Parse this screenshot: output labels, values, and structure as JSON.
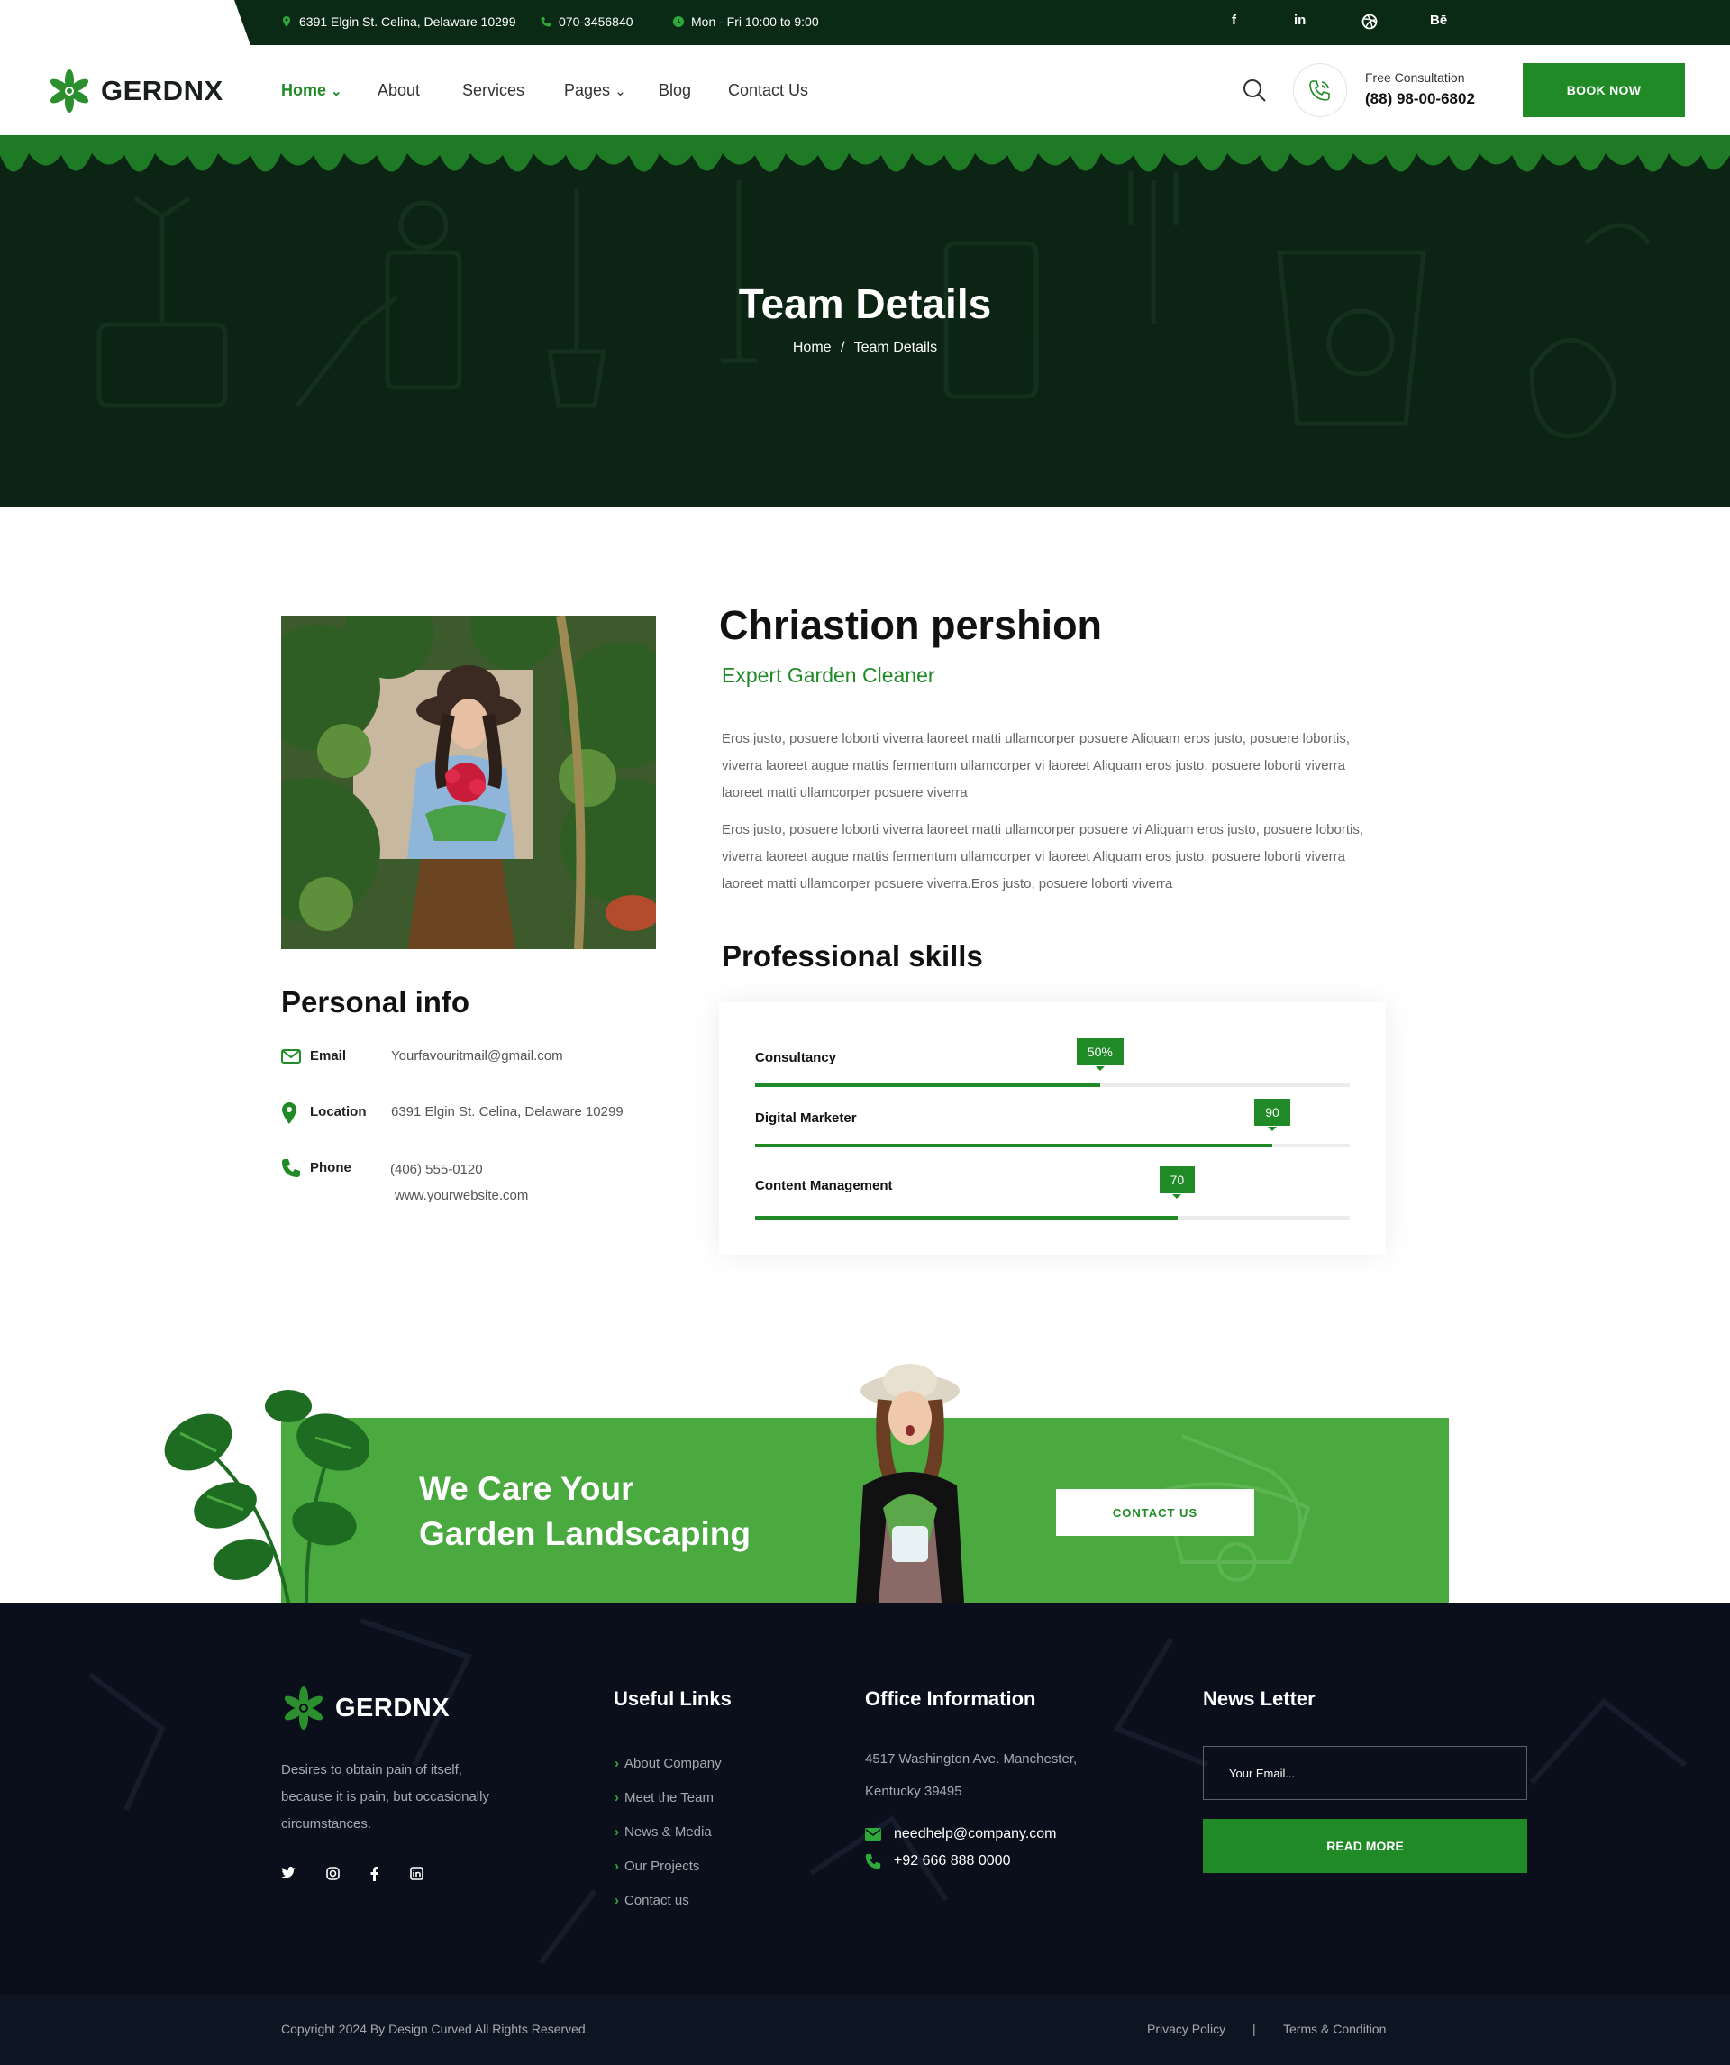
{
  "topbar": {
    "address": "6391 Elgin St. Celina, Delaware 10299",
    "phone": "070-3456840",
    "hours": "Mon - Fri 10:00 to 9:00",
    "social": [
      "f",
      "in",
      "dribbble-icon",
      "Bē"
    ]
  },
  "header": {
    "brand": "GERDNX",
    "nav": [
      "Home",
      "About",
      "Services",
      "Pages",
      "Blog",
      "Contact Us"
    ],
    "consult_label": "Free Consultation",
    "consult_phone": "(88) 98-00-6802",
    "book_label": "BOOK NOW"
  },
  "hero": {
    "title": "Team Details",
    "crumb_home": "Home",
    "crumb_sep": "/",
    "crumb_current": "Team Details"
  },
  "profile": {
    "name": "Chriastion pershion",
    "role": "Expert Garden Cleaner",
    "para1": "Eros justo, posuere loborti viverra laoreet matti ullamcorper posuere Aliquam eros justo, posuere lobortis, viverra laoreet augue mattis fermentum ullamcorper vi laoreet Aliquam eros justo, posuere loborti viverra laoreet matti ullamcorper posuere viverra",
    "para2": "Eros justo, posuere loborti viverra laoreet matti ullamcorper posuere vi Aliquam eros justo, posuere lobortis, viverra laoreet augue mattis fermentum ullamcorper vi laoreet Aliquam eros justo, posuere loborti viverra laoreet matti ullamcorper posuere viverra.Eros justo, posuere loborti viverra"
  },
  "personal": {
    "title": "Personal info",
    "email_label": "Email",
    "email": "Yourfavouritmail@gmail.com",
    "location_label": "Location",
    "location": "6391 Elgin St. Celina, Delaware 10299",
    "phone_label": "Phone",
    "phone": "(406) 555-0120",
    "website": "www.yourwebsite.com"
  },
  "skills": {
    "title": "Professional skills",
    "items": [
      {
        "label": "Consultancy",
        "badge": "50%",
        "value": 58
      },
      {
        "label": "Digital Marketer",
        "badge": "90",
        "value": 87
      },
      {
        "label": "Content Management",
        "badge": "70",
        "value": 71
      }
    ]
  },
  "cta": {
    "line1": "We Care Your",
    "line2": "Garden Landscaping",
    "button": "CONTACT US"
  },
  "footer": {
    "brand": "GERDNX",
    "about": [
      "Desires to obtain pain of itself,",
      "because it is pain, but occasionally",
      "circumstances."
    ],
    "links_title": "Useful Links",
    "links": [
      "About Company",
      "Meet the Team",
      "News & Media",
      "Our Projects",
      "Contact us"
    ],
    "office_title": "Office Information",
    "office_addr1": "4517 Washington Ave. Manchester,",
    "office_addr2": "Kentucky 39495",
    "office_email": "needhelp@company.com",
    "office_phone": "+92 666 888 0000",
    "news_title": "News Letter",
    "news_placeholder": "Your Email...",
    "news_button": "READ MORE",
    "copyright": "Copyright  2024 By Design Curved All Rights Reserved.",
    "privacy": "Privacy Policy",
    "sep": "|",
    "terms": "Terms & Condition"
  },
  "colors": {
    "accent": "#1f8a26",
    "dark_green": "#0b2a16",
    "cta_green": "#4aa93f",
    "footer_bg": "#0a0f1b"
  }
}
